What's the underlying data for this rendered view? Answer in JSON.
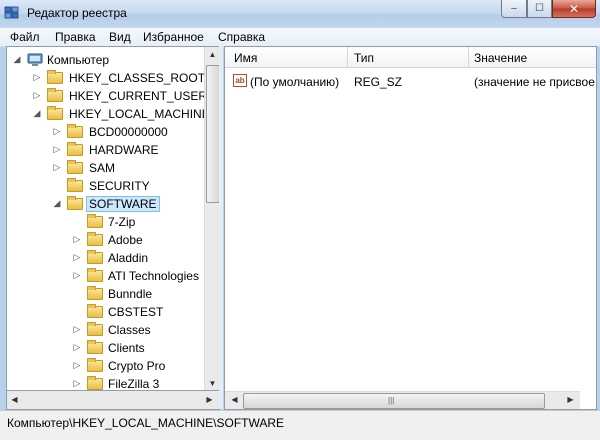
{
  "window": {
    "title": "Редактор реестра",
    "close_glyph": "✕",
    "max_glyph": "☐",
    "min_glyph": "–"
  },
  "menu": [
    "Файл",
    "Правка",
    "Вид",
    "Избранное",
    "Справка"
  ],
  "tree": {
    "root": "Компьютер",
    "hives": [
      "HKEY_CLASSES_ROOT",
      "HKEY_CURRENT_USER",
      "HKEY_LOCAL_MACHINE"
    ],
    "hklm_children": [
      "BCD00000000",
      "HARDWARE",
      "SAM",
      "SECURITY",
      "SOFTWARE"
    ],
    "software_children": [
      "7-Zip",
      "Adobe",
      "Aladdin",
      "ATI Technologies",
      "Bunndle",
      "CBSTEST",
      "Classes",
      "Clients",
      "Crypto Pro",
      "FileZilla 3"
    ]
  },
  "columns": {
    "name": "Имя",
    "type": "Тип",
    "value": "Значение"
  },
  "values": [
    {
      "name": "(По умолчанию)",
      "type": "REG_SZ",
      "data": "(значение не присвое",
      "icon_text": "ab"
    }
  ],
  "status": "Компьютер\\HKEY_LOCAL_MACHINE\\SOFTWARE",
  "colors": {
    "selection": "#cce8ff",
    "titlebar": "#c5d9ef",
    "frame": "#b9d1ea"
  }
}
